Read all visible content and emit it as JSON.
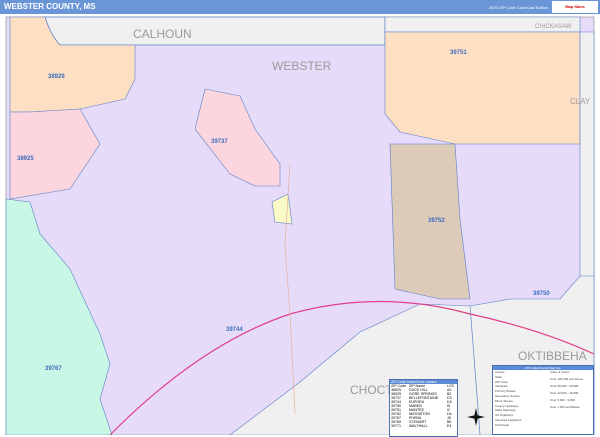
{
  "header": {
    "title": "WEBSTER COUNTY, MS",
    "edition": "2020 ZIP Code ColorCast Edition",
    "logo": "Map Sales"
  },
  "counties": {
    "calhoun": "CALHOUN",
    "webster": "WEBSTER",
    "chickasaw": "CHICKASAW",
    "clay": "CLAY",
    "oktibbeha": "OKTIBBEHA",
    "choctaw": "CHOCTAW"
  },
  "zips": [
    "38929",
    "38925",
    "39737",
    "39751",
    "39752",
    "39744",
    "39750",
    "39767"
  ],
  "legend": {
    "title": "ZIP Code Index/Grid Locator",
    "columns": [
      "ZIP Code",
      "ZIP Name",
      "LOC"
    ],
    "rows": [
      [
        "38925",
        "DUCK HILL",
        "A2"
      ],
      [
        "38929",
        "GORE SPRINGS",
        "B2"
      ],
      [
        "39737",
        "BELLEFONTAINE",
        "D3"
      ],
      [
        "39744",
        "EUPORA",
        "D4"
      ],
      [
        "39750",
        "MABEN",
        "I5"
      ],
      [
        "39751",
        "MANTEE",
        "I2"
      ],
      [
        "39752",
        "MATHISTON",
        "H4"
      ],
      [
        "39767",
        "PHEBA",
        "J6"
      ],
      [
        "39769",
        "STEWART",
        "B5"
      ],
      [
        "39771",
        "WALTHALL",
        "E4"
      ]
    ]
  },
  "key": {
    "title": "ZIP Code/County Map Key",
    "items": [
      "County",
      "State",
      "ZIP Code",
      "Interstate",
      "Primary Streets",
      "Secondary Streets",
      "Minor Streets",
      "County Highways",
      "State Highways",
      "US Highways",
      "Interstate Highways",
      "Toll Roads"
    ],
    "cities": [
      "Cities & Towns",
      "Over 100,000 and Above",
      "Over 50,000 - 99,999",
      "Over 10,000 - 49,999",
      "Over 5,000 - 9,999",
      "Over 1,000 and Below"
    ]
  },
  "colors": {
    "webster": "#e6dcfa",
    "orange": "#fde0c4",
    "pink": "#fbd6de",
    "green": "#c9f7e6",
    "tan": "#dccbb8",
    "gray": "#f0f0f0",
    "header": "#6a96d8"
  }
}
